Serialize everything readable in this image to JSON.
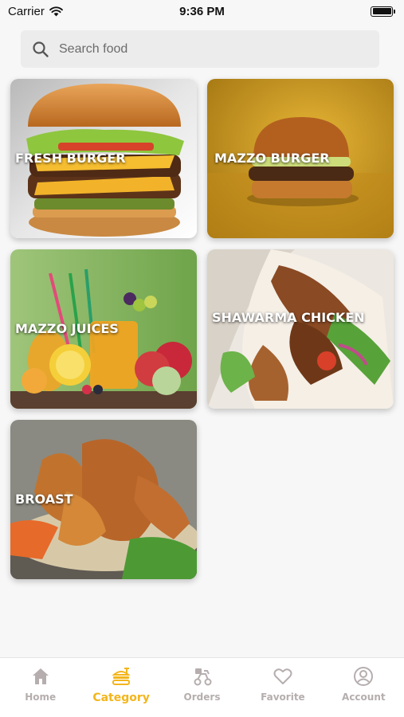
{
  "status_bar": {
    "carrier": "Carrier",
    "time": "9:36 PM"
  },
  "search": {
    "placeholder": "Search food",
    "value": ""
  },
  "categories": [
    {
      "label": "FRESH BURGER"
    },
    {
      "label": "MAZZO BURGER"
    },
    {
      "label": "MAZZO JUICES"
    },
    {
      "label": "SHAWARMA CHICKEN"
    },
    {
      "label": "BROAST"
    }
  ],
  "tabs": [
    {
      "label": "Home",
      "icon": "home-icon",
      "active": false
    },
    {
      "label": "Category",
      "icon": "category-icon",
      "active": true
    },
    {
      "label": "Orders",
      "icon": "orders-icon",
      "active": false
    },
    {
      "label": "Favorite",
      "icon": "heart-icon",
      "active": false
    },
    {
      "label": "Account",
      "icon": "account-icon",
      "active": false
    }
  ],
  "colors": {
    "accent": "#f3b51b",
    "tab_inactive": "#b6aeae",
    "background": "#f7f7f7"
  }
}
